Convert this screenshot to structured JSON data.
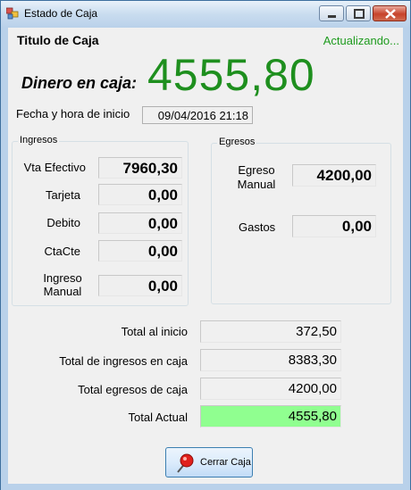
{
  "window": {
    "title": "Estado de Caja",
    "controls": {
      "minimize": "minimize-icon",
      "maximize": "maximize-icon",
      "close": "close-icon"
    }
  },
  "header": {
    "caja_title": "Titulo de Caja",
    "status": "Actualizando...",
    "status_color": "#1e9b1e"
  },
  "dinero": {
    "label": "Dinero en caja:",
    "value": "4555,80",
    "value_color": "#1e8f1e"
  },
  "fecha": {
    "label": "Fecha y hora de inicio",
    "value": "09/04/2016 21:18"
  },
  "ingresos": {
    "title": "Ingresos",
    "items": [
      {
        "label": "Vta Efectivo",
        "value": "7960,30"
      },
      {
        "label": "Tarjeta",
        "value": "0,00"
      },
      {
        "label": "Debito",
        "value": "0,00"
      },
      {
        "label": "CtaCte",
        "value": "0,00"
      },
      {
        "label": "Ingreso\nManual",
        "value": "0,00"
      }
    ]
  },
  "egresos": {
    "title": "Egresos",
    "items": [
      {
        "label": "Egreso\nManual",
        "value": "4200,00"
      },
      {
        "label": "Gastos",
        "value": "0,00"
      }
    ]
  },
  "totales": [
    {
      "label": "Total al inicio",
      "value": "372,50"
    },
    {
      "label": "Total de ingresos en caja",
      "value": "8383,30"
    },
    {
      "label": "Total egresos de caja",
      "value": "4200,00"
    },
    {
      "label": "Total Actual",
      "value": "4555,80",
      "highlight": "#90ff90"
    }
  ],
  "close_button": {
    "label": "Cerrar Caja",
    "icon": "pin-icon"
  }
}
